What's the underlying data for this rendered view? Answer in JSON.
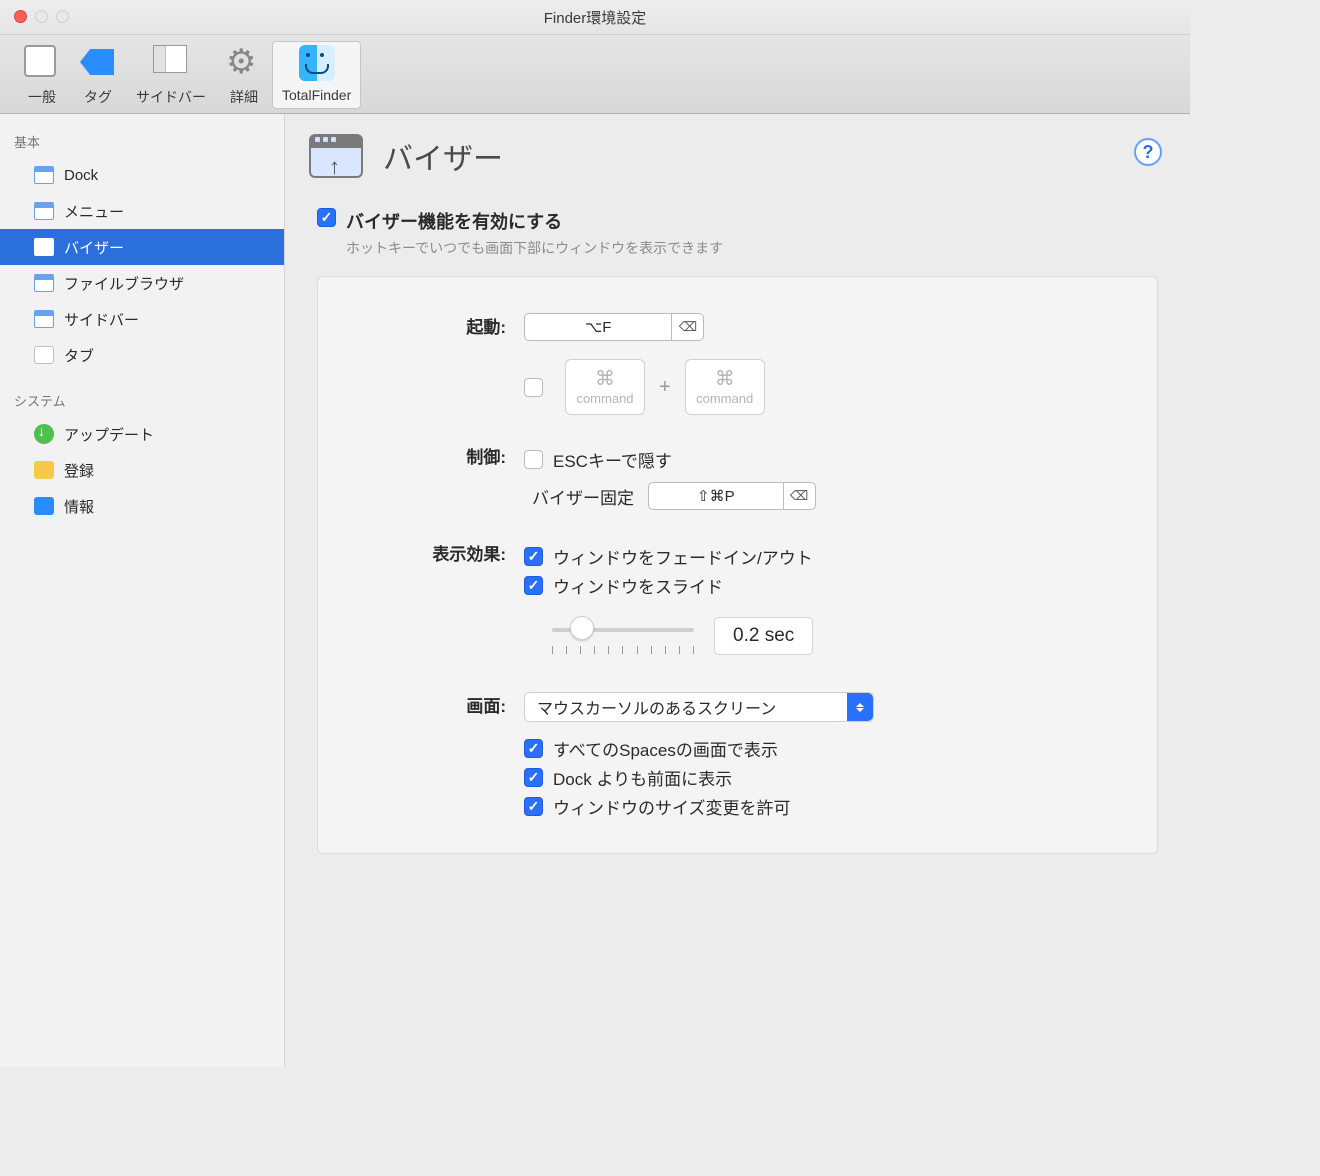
{
  "window": {
    "title": "Finder環境設定"
  },
  "toolbar": {
    "items": [
      {
        "label": "一般"
      },
      {
        "label": "タグ"
      },
      {
        "label": "サイドバー"
      },
      {
        "label": "詳細"
      },
      {
        "label": "TotalFinder"
      }
    ],
    "selected": 4
  },
  "sidebar": {
    "group1_title": "基本",
    "group1": [
      {
        "label": "Dock"
      },
      {
        "label": "メニュー"
      },
      {
        "label": "バイザー"
      },
      {
        "label": "ファイルブラウザ"
      },
      {
        "label": "サイドバー"
      },
      {
        "label": "タブ"
      }
    ],
    "group2_title": "システム",
    "group2": [
      {
        "label": "アップデート"
      },
      {
        "label": "登録"
      },
      {
        "label": "情報"
      }
    ],
    "selected": 2
  },
  "page": {
    "title": "バイザー",
    "help": "?",
    "enable": {
      "checked": true,
      "label": "バイザー機能を有効にする",
      "desc": "ホットキーでいつでも画面下部にウィンドウを表示できます"
    },
    "labels": {
      "activation": "起動:",
      "control": "制御:",
      "effects": "表示効果:",
      "screen": "画面:",
      "pin": "バイザー固定",
      "command": "command",
      "plus": "+"
    },
    "hotkeys": {
      "activation": "⌥F",
      "pin": "⇧⌘P"
    },
    "control_esc": {
      "checked": false,
      "label": "ESCキーで隠す"
    },
    "effects": {
      "fade": {
        "checked": true,
        "label": "ウィンドウをフェードイン/アウト"
      },
      "slide": {
        "checked": true,
        "label": "ウィンドウをスライド"
      },
      "duration": "0.2 sec"
    },
    "screen": {
      "select_value": "マウスカーソルのあるスクリーン",
      "spaces": {
        "checked": true,
        "label": "すべてのSpacesの画面で表示"
      },
      "above_dock": {
        "checked": true,
        "label": "Dock よりも前面に表示"
      },
      "resize": {
        "checked": true,
        "label": "ウィンドウのサイズ変更を許可"
      }
    }
  }
}
